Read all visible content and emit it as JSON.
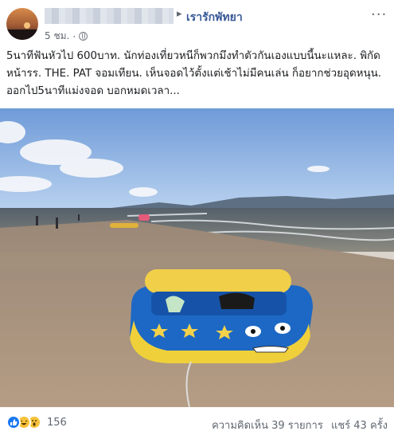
{
  "header": {
    "group_name": "เรารักพัทยา",
    "time": "5 ชม.",
    "separator": "·",
    "arrow": "▸",
    "more": "···",
    "icons": {
      "globe": "globe-icon",
      "more": "more-options-icon"
    }
  },
  "post": {
    "text": "5นาทีฟันหัวไป 600บาท. นักท่องเที่ยวหนีก็พวกมึงทำตัวกันเองแบบนี้นะแหละ. พิกัดหน้ารร. THE. PAT จอมเทียน. เห็นจอดไว้ตั้งแต่เช้าไม่มีคนเล่น ก็อยากช่วยอุดหนุน. ออกไป5นาทีแม่งจอด บอกหมดเวลา..."
  },
  "footer": {
    "reaction_count": "156",
    "comments": "ความคิดเห็น 39 รายการ",
    "shares": "แชร์ 43 ครั้ง",
    "reactions": [
      "like-icon",
      "haha-icon",
      "wow-icon"
    ]
  },
  "colors": {
    "link": "#385898",
    "meta": "#606770",
    "like": "#1877f2",
    "emoji": "#f7c23a"
  }
}
